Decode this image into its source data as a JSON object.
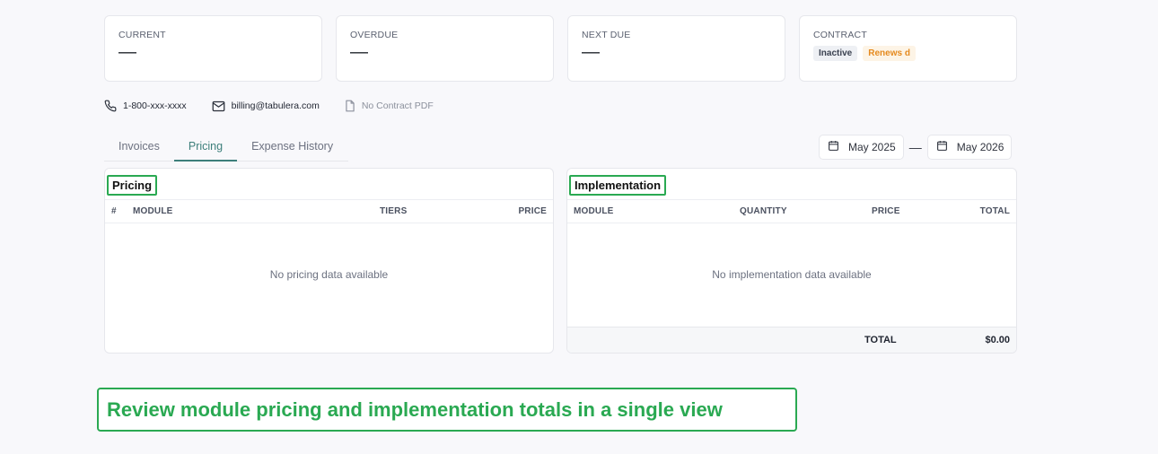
{
  "cards": {
    "current": {
      "label": "CURRENT",
      "value": "—"
    },
    "overdue": {
      "label": "OVERDUE",
      "value": "—"
    },
    "next_due": {
      "label": "NEXT DUE",
      "value": "—"
    },
    "contract": {
      "label": "CONTRACT",
      "status_badge": "Inactive",
      "renew_badge": "Renews d"
    }
  },
  "contact": {
    "phone": "1-800-xxx-xxxx",
    "email": "billing@tabulera.com",
    "contract_pdf": "No Contract PDF",
    "icons": [
      "phone-icon",
      "mail-icon",
      "document-icon"
    ]
  },
  "tabs": [
    {
      "label": "Invoices",
      "active": false
    },
    {
      "label": "Pricing",
      "active": true
    },
    {
      "label": "Expense History",
      "active": false
    }
  ],
  "date_range": {
    "start": "May 2025",
    "separator": "—",
    "end": "May 2026",
    "icon": "calendar-icon"
  },
  "pricing_panel": {
    "title": "Pricing",
    "columns": [
      "#",
      "MODULE",
      "TIERS",
      "PRICE"
    ],
    "empty_text": "No pricing data available"
  },
  "implementation_panel": {
    "title": "Implementation",
    "columns": [
      "MODULE",
      "QUANTITY",
      "PRICE",
      "TOTAL"
    ],
    "empty_text": "No implementation data available",
    "total_label": "TOTAL",
    "total_value": "$0.00"
  },
  "caption": "Review module pricing and implementation totals in a single view",
  "colors": {
    "accent": "#3d7f7b",
    "highlight": "#2aa952",
    "renew": "#e58a1f"
  }
}
